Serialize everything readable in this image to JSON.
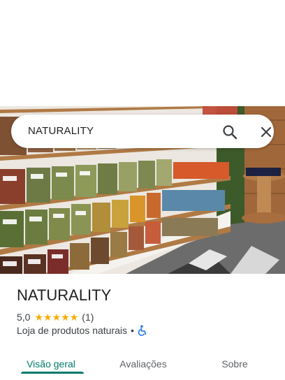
{
  "search": {
    "query": "NATURALITY",
    "search_icon": "search-icon",
    "close_icon": "close-icon"
  },
  "place": {
    "title": "NATURALITY",
    "rating": "5,0",
    "stars": 5,
    "review_count": "(1)",
    "category": "Loja de produtos naturais",
    "separator": "•",
    "accessibility_icon": "wheelchair-icon"
  },
  "tabs": [
    {
      "label": "Visão geral",
      "active": true
    },
    {
      "label": "Avaliações",
      "active": false
    },
    {
      "label": "Sobre",
      "active": false
    }
  ],
  "colors": {
    "accent": "#00796b",
    "star": "#f9ab00",
    "access": "#1a73e8"
  }
}
